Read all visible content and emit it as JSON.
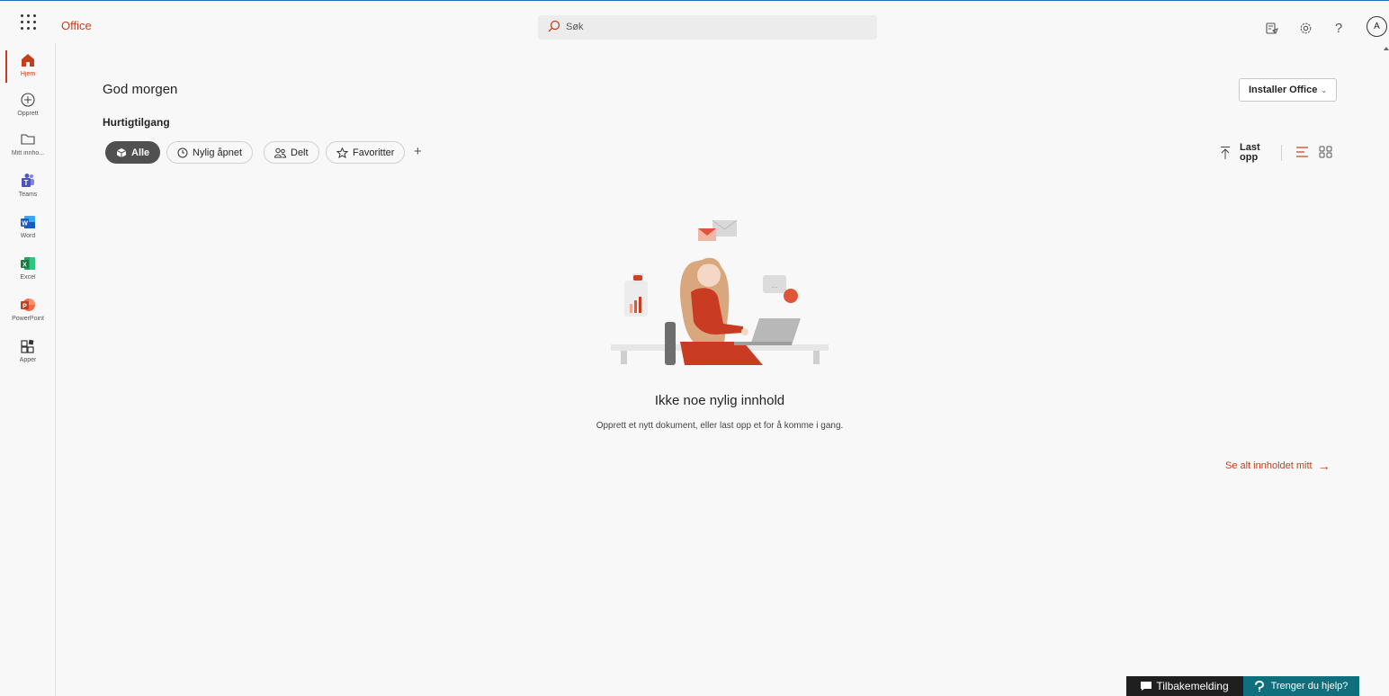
{
  "header": {
    "brand": "Office",
    "search_placeholder": "Søk",
    "avatar_initial": "A",
    "help_glyph": "?"
  },
  "rail": {
    "items": [
      {
        "label": "Hjem",
        "icon": "home-icon"
      },
      {
        "label": "Opprett",
        "icon": "plus-circle-icon"
      },
      {
        "label": "Mitt innho...",
        "icon": "folder-icon"
      },
      {
        "label": "Teams",
        "icon": "teams-icon"
      },
      {
        "label": "Word",
        "icon": "word-icon"
      },
      {
        "label": "Excel",
        "icon": "excel-icon"
      },
      {
        "label": "PowerPoint",
        "icon": "powerpoint-icon"
      },
      {
        "label": "Apper",
        "icon": "apps-icon"
      }
    ]
  },
  "main": {
    "greeting": "God morgen",
    "quick_access": "Hurtigtilgang",
    "filters": [
      "Alle",
      "Nylig åpnet",
      "Delt",
      "Favoritter"
    ],
    "add_glyph": "+",
    "install_label": "Installer Office",
    "upload_line1": "Last",
    "upload_line2": "opp",
    "empty_title": "Ikke noe nylig innhold",
    "empty_subtitle": "Opprett et nytt dokument, eller last opp et for å komme i gang.",
    "see_all": "Se alt innholdet mitt",
    "arrow_glyph": "→"
  },
  "footer": {
    "feedback": "Tilbakemelding",
    "help": "Trenger du hjelp?"
  },
  "colors": {
    "accent": "#c43e1c",
    "active_pill": "#505050",
    "help_bg": "#0f6f7c",
    "feedback_bg": "#1f1f1f"
  }
}
